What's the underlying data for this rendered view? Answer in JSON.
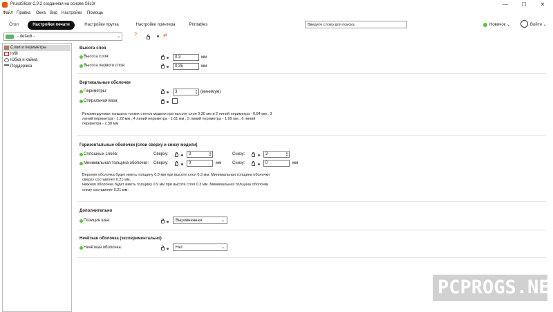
{
  "window": {
    "title": "PrusaSlicer-2.9.2 созданная на основе Slic3r",
    "minimize": "—",
    "maximize": "☐",
    "close": "✕"
  },
  "menu": [
    "Файл",
    "Правка",
    "Окна",
    "Вид",
    "Настройки",
    "Помощь"
  ],
  "tabs": [
    {
      "label": "Стол",
      "active": false
    },
    {
      "label": "Настройки печати",
      "active": true
    },
    {
      "label": "Настройки прутка",
      "active": false
    },
    {
      "label": "Настройки принтера",
      "active": false
    },
    {
      "label": "Printables",
      "active": false
    }
  ],
  "search": {
    "placeholder": "Введите слово для поиска"
  },
  "mode": {
    "label": "Новичок",
    "arrow": "⌄",
    "color": "#5bc73d"
  },
  "account": {
    "label": "Войти",
    "arrow": "⌄"
  },
  "preset": {
    "name": "- default -",
    "arrow": "⌄"
  },
  "toolbar_icons": [
    "help-icon",
    "compare-icon"
  ],
  "sidebar": {
    "items": [
      {
        "label": "Слои и периметры",
        "selected": true,
        "icon": "layers-icon"
      },
      {
        "label": "Infill",
        "selected": false,
        "icon": "infill-icon"
      },
      {
        "label": "Юбка и кайма",
        "selected": false,
        "icon": "skirt-icon"
      },
      {
        "label": "Поддержка",
        "selected": false,
        "icon": "support-icon"
      }
    ]
  },
  "sections": {
    "layer_height": {
      "title": "Высота слоя",
      "layer_height_label": "Высота слоя:",
      "layer_height_value": "0,3",
      "layer_height_unit": "мм",
      "first_layer_label": "Высота первого слоя:",
      "first_layer_value": "0,35",
      "first_layer_unit": "мм"
    },
    "vertical_shells": {
      "title": "Вертикальные оболочки",
      "perimeters_label": "Периметры:",
      "perimeters_value": "3",
      "perimeters_unit": "(минимум)",
      "spiral_label": "Спиральная ваза:",
      "desc_lines": [
        "Рекомендуемая толщина тонких стенок модели при высоте слоя 0.30 мм и 2 линий периметра - 0.84 мм , 3",
        "линий периметра - 1.22 мм , 4 линий периметра - 1.61 мм , 5 линий периметра - 1.99 мм , 6 линий",
        "периметра - 2.38 мм"
      ]
    },
    "horizontal_shells": {
      "title": "Горизонтальные оболочки (слои сверху и снизу модели)",
      "solid_layers_label": "Сплошных слоёв:",
      "top_label": "Сверху:",
      "top_value": "3",
      "bottom_label": "Снизу:",
      "bottom_value": "3",
      "min_thickness_label": "Минимальная толщина оболочки:",
      "top_min_label": "Сверху:",
      "top_min_value": "0",
      "top_min_unit": "мм",
      "bottom_min_label": "Снизу:",
      "bottom_min_value": "0",
      "bottom_min_unit": "мм",
      "desc_lines": [
        "Верхняя оболочка будет иметь толщину 0.9 мм при высоте слоя 0.3 мм. Минимальная толщина оболочки",
        "сверху составляет 0.21 мм.",
        "Нижняя оболочка будет иметь толщину 0.9 мм при высоте слоя 0.3 мм. Минимальная толщина оболочки",
        "снизу составляет 0.21 мм."
      ]
    },
    "advanced": {
      "title": "Дополнительно",
      "seam_label": "Позиция шва:",
      "seam_value": "Выровненная"
    },
    "fuzzy": {
      "title": "Нечёткая оболочка (экспериментально)",
      "fuzzy_label": "Нечёткая оболочка:",
      "fuzzy_value": "Нет"
    }
  },
  "colors": {
    "accent_green": "#5bc73d",
    "accent_orange": "#e8590c",
    "active_tab": "#111111"
  },
  "watermark": "PCPROGS.NET"
}
